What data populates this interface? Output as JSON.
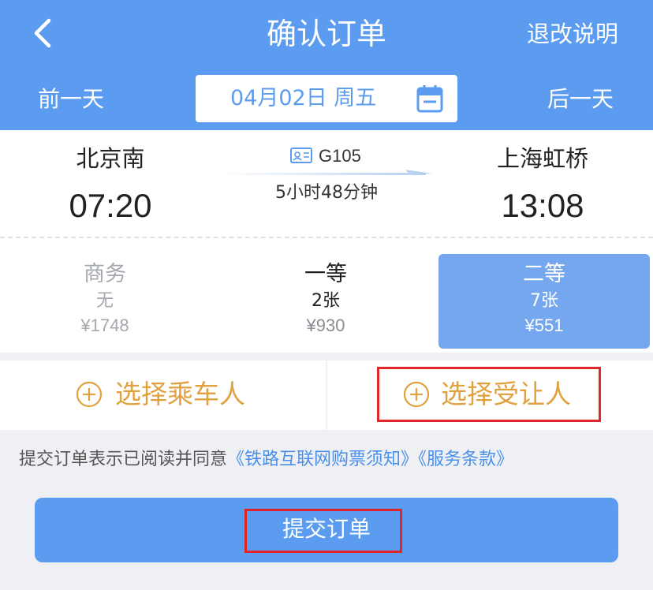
{
  "header": {
    "title": "确认订单",
    "refund_link": "退改说明",
    "prev_day": "前一天",
    "next_day": "后一天",
    "date": "04月02日 周五",
    "accent_color": "#5b9cf1"
  },
  "train": {
    "from_station": "北京南",
    "depart_time": "07:20",
    "train_number": "G105",
    "duration": "5小时48分钟",
    "to_station": "上海虹桥",
    "arrive_time": "13:08"
  },
  "seats": [
    {
      "class": "商务",
      "count": "无",
      "price": "¥1748",
      "state": "disabled"
    },
    {
      "class": "一等",
      "count": "2张",
      "price": "¥930",
      "state": "normal"
    },
    {
      "class": "二等",
      "count": "7张",
      "price": "¥551",
      "state": "selected"
    }
  ],
  "select": {
    "passenger": "选择乘车人",
    "transferee": "选择受让人",
    "accent_color": "#e0a13e"
  },
  "agreement": {
    "prefix": "提交订单表示已阅读并同意",
    "notice_link": "《铁路互联网购票须知》",
    "terms_link": "《服务条款》"
  },
  "submit": {
    "label": "提交订单"
  },
  "highlight_color": "#e0262b"
}
